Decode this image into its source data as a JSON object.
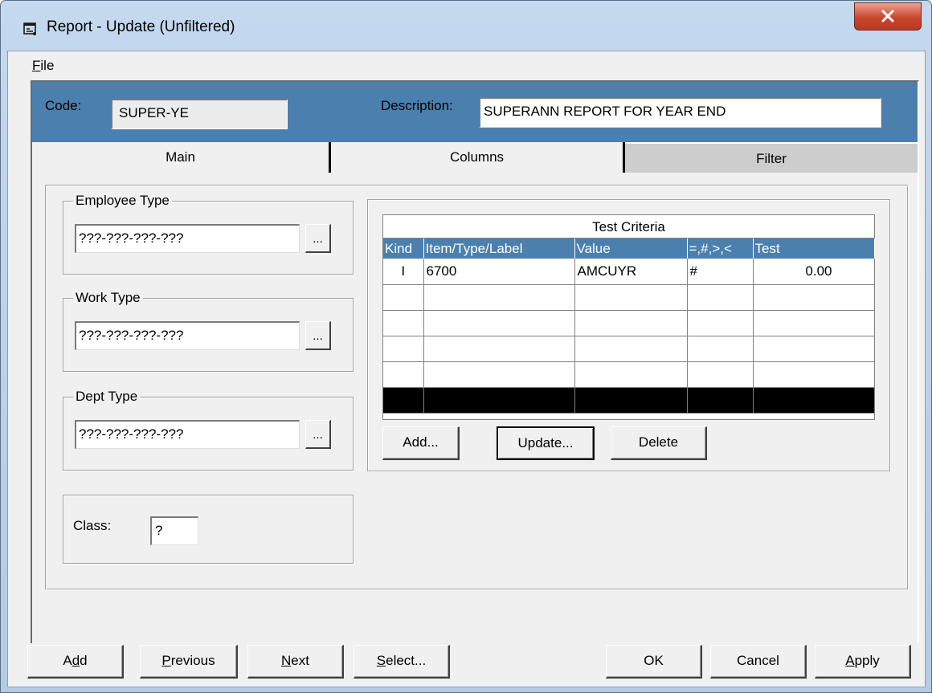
{
  "window": {
    "title": "Report - Update (Unfiltered)"
  },
  "menu": {
    "file_label": "File",
    "file_accel": "F",
    "file_rest": "ile"
  },
  "header": {
    "code_label": "Code:",
    "code_value": "SUPER-YE",
    "description_label": "Description:",
    "description_value": "SUPERANN REPORT FOR YEAR END"
  },
  "tabs": [
    {
      "label": "Main",
      "active": false
    },
    {
      "label": "Columns",
      "active": false
    },
    {
      "label": "Filter",
      "active": true
    }
  ],
  "filters": {
    "employee_type": {
      "label": "Employee Type",
      "value": "???-???-???-???"
    },
    "work_type": {
      "label": "Work Type",
      "value": "???-???-???-???"
    },
    "dept_type": {
      "label": "Dept Type",
      "value": "???-???-???-???"
    },
    "class": {
      "label": "Class:",
      "value": "?"
    },
    "browse_label": "..."
  },
  "criteria": {
    "title": "Test Criteria",
    "columns": [
      "Kind",
      "Item/Type/Label",
      "Value",
      "=,#,>,<",
      "Test"
    ],
    "rows": [
      [
        "I",
        "6700",
        "AMCUYR",
        "#",
        "0.00"
      ],
      [
        "",
        "",
        "",
        "",
        ""
      ],
      [
        "",
        "",
        "",
        "",
        ""
      ],
      [
        "",
        "",
        "",
        "",
        ""
      ],
      [
        "",
        "",
        "",
        "",
        ""
      ],
      [
        "",
        "",
        "",
        "",
        ""
      ]
    ],
    "buttons": {
      "add": "Add...",
      "update": "Update...",
      "delete": "Delete"
    }
  },
  "footer": {
    "add": {
      "pre": "A",
      "accel": "d",
      "post": "d"
    },
    "previous": {
      "pre": "",
      "accel": "P",
      "post": "revious"
    },
    "next": {
      "pre": "",
      "accel": "N",
      "post": "ext"
    },
    "select": {
      "pre": "",
      "accel": "S",
      "post": "elect..."
    },
    "ok": "OK",
    "cancel": "Cancel",
    "apply": {
      "pre": "",
      "accel": "A",
      "post": "pply"
    }
  }
}
